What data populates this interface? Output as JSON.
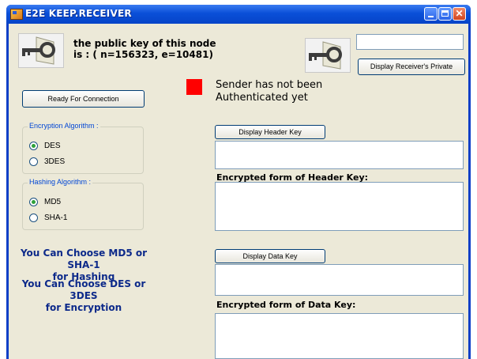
{
  "window": {
    "title": "E2E KEEP.RECEIVER",
    "minimize_label": "",
    "maximize_label": "",
    "close_label": "✕"
  },
  "public_key": {
    "line1": "the public key of this node",
    "line2": " is : ( n=156323, e=10481)"
  },
  "receiver_private": {
    "field_value": "",
    "button_label": "Display Receiver's Private"
  },
  "connection": {
    "ready_button_label": "Ready For Connection"
  },
  "status": {
    "line1": "Sender has not been",
    "line2": "Authenticated yet",
    "color": "#ff0000"
  },
  "encryption": {
    "group_title": "Encryption Algorithm :",
    "options": [
      "DES",
      "3DES"
    ],
    "selected": "DES"
  },
  "hashing": {
    "group_title": "Hashing Algorithm :",
    "options": [
      "MD5",
      "SHA-1"
    ],
    "selected": "MD5"
  },
  "notes": {
    "hash_line1": "You Can Choose MD5 or SHA-1",
    "hash_line2": "for Hashing",
    "enc_line1": "You Can Choose DES or 3DES",
    "enc_line2": "for Encryption"
  },
  "header_key": {
    "button_label": "Display Header Key",
    "value": "",
    "encrypted_label": "Encrypted form of  Header Key:",
    "encrypted_value": ""
  },
  "data_key": {
    "button_label": "Display Data Key",
    "value": "",
    "encrypted_label": "Encrypted form of  Data Key:",
    "encrypted_value": ""
  },
  "icons": [
    "app-icon",
    "key-icon"
  ]
}
